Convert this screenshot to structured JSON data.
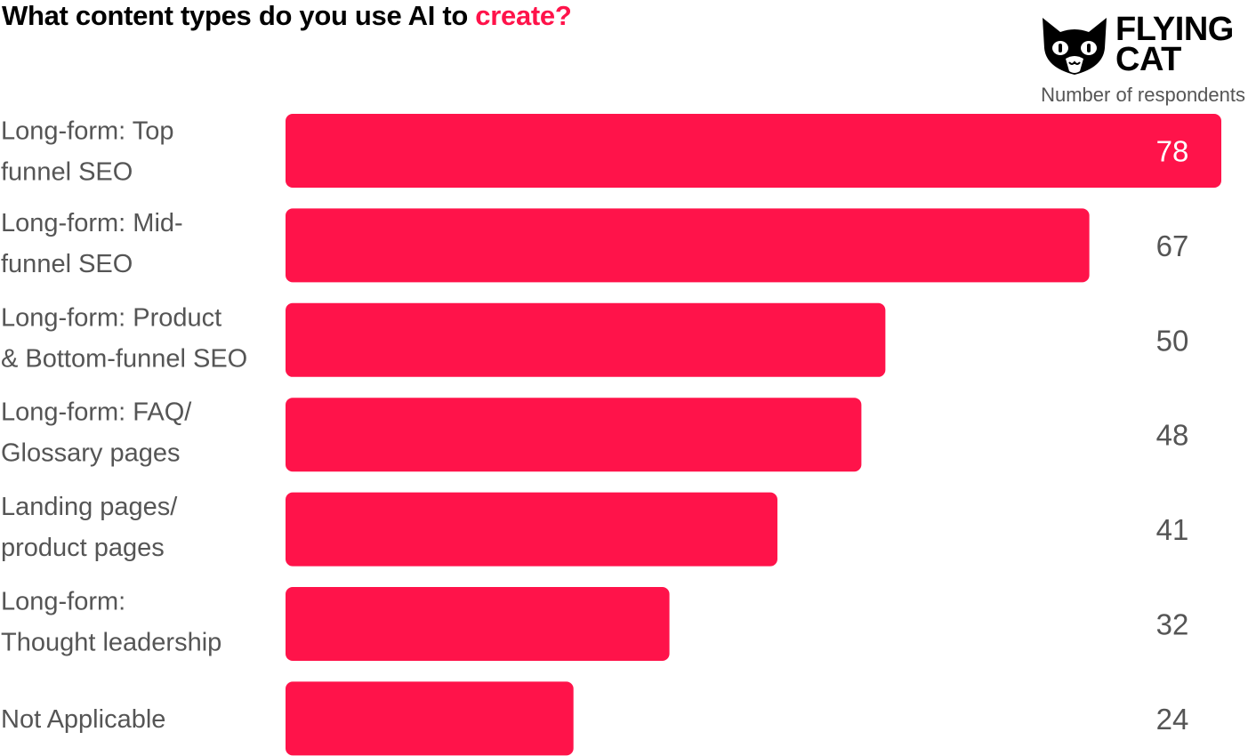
{
  "header": {
    "title_prefix": "What content types do you use AI to ",
    "title_highlight": "create?",
    "logo_line1": "FLYING",
    "logo_line2": "CAT",
    "subtitle": "Number of respondents"
  },
  "colors": {
    "bar": "#ff134a",
    "label": "#555555",
    "title": "#000000"
  },
  "chart_data": {
    "type": "bar",
    "orientation": "horizontal",
    "title": "What content types do you use AI to create?",
    "xlabel": "Number of respondents",
    "ylabel": "",
    "xlim": [
      0,
      78
    ],
    "grid": false,
    "categories": [
      [
        "Long-form: Top",
        "funnel SEO"
      ],
      [
        "Long-form: Mid-",
        "funnel SEO"
      ],
      [
        "Long-form: Product",
        "& Bottom-funnel SEO"
      ],
      [
        "Long-form: FAQ/",
        "Glossary pages"
      ],
      [
        "Landing pages/",
        "product pages"
      ],
      [
        "Long-form:",
        "Thought leadership"
      ],
      [
        "Not Applicable"
      ]
    ],
    "values": [
      78,
      67,
      50,
      48,
      41,
      32,
      24
    ]
  }
}
